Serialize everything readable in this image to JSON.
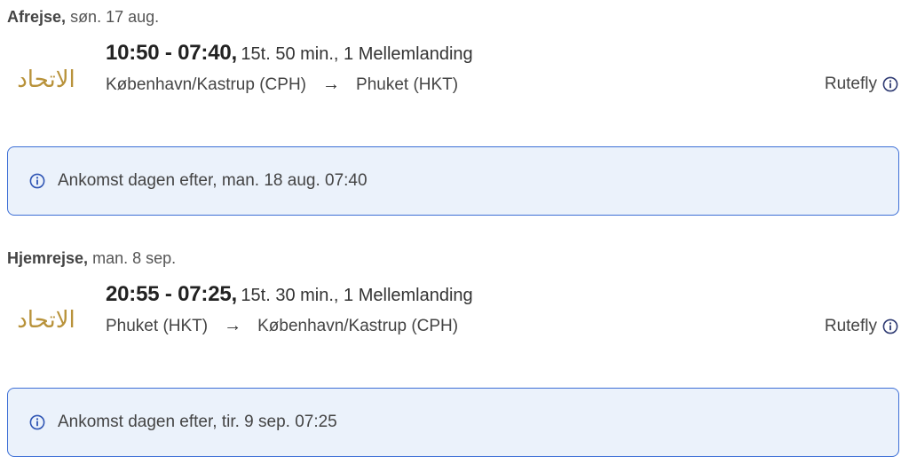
{
  "outbound": {
    "heading_bold": "Afrejse,",
    "heading_date": "søn. 17 aug.",
    "times": "10:50 - 07:40,",
    "duration": "15t. 50 min., 1 Mellemlanding",
    "origin": "København/Kastrup",
    "origin_code": "(CPH)",
    "arrow": "→",
    "destination": "Phuket",
    "destination_code": "(HKT)",
    "fare_type": "Rutefly",
    "notice": "Ankomst dagen efter, man. 18 aug. 07:40"
  },
  "return": {
    "heading_bold": "Hjemrejse,",
    "heading_date": "man. 8 sep.",
    "times": "20:55 - 07:25,",
    "duration": "15t. 30 min., 1 Mellemlanding",
    "origin": "Phuket",
    "origin_code": "(HKT)",
    "arrow": "→",
    "destination": "København/Kastrup",
    "destination_code": "(CPH)",
    "fare_type": "Rutefly",
    "notice": "Ankomst dagen efter, tir. 9 sep. 07:25"
  },
  "airline_logo": "الاتحاد",
  "colors": {
    "logo_gold": "#b8923a",
    "notice_bg": "#ebf2fb",
    "notice_border": "#3d6fd6",
    "info_blue": "#2f55b4"
  }
}
